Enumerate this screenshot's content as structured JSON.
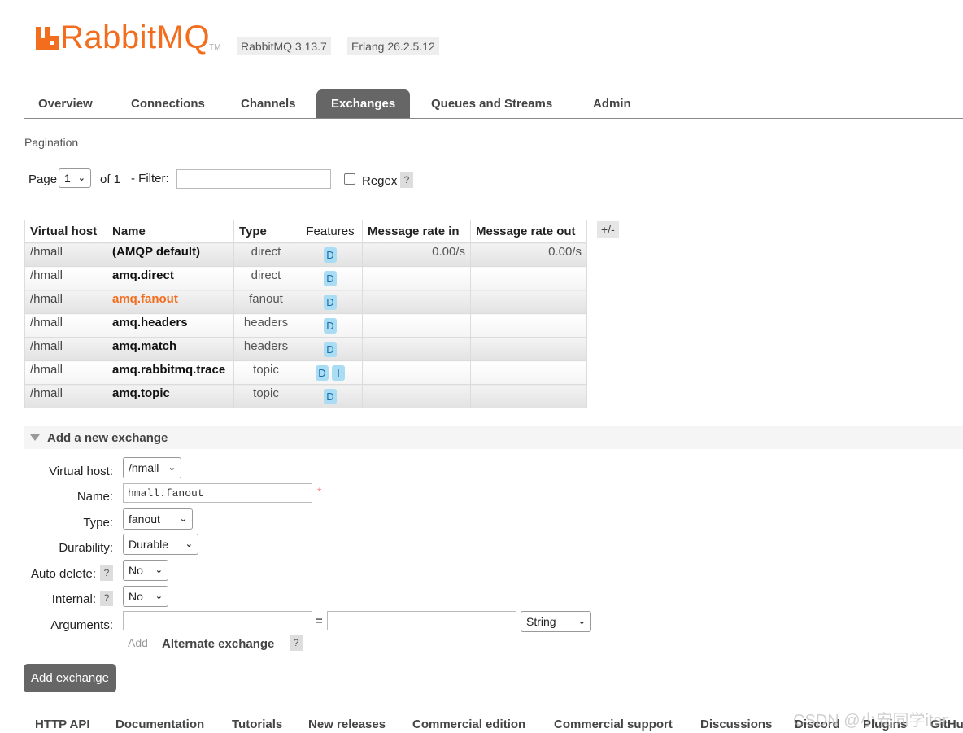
{
  "header": {
    "logo_text": "RabbitMQ",
    "logo_tm": "TM",
    "rabbitmq_version": "RabbitMQ 3.13.7",
    "erlang_version": "Erlang 26.2.5.12",
    "brand_color": "#f36d1f"
  },
  "tabs": [
    {
      "label": "Overview",
      "active": false
    },
    {
      "label": "Connections",
      "active": false
    },
    {
      "label": "Channels",
      "active": false
    },
    {
      "label": "Exchanges",
      "active": true
    },
    {
      "label": "Queues and Streams",
      "active": false
    },
    {
      "label": "Admin",
      "active": false
    }
  ],
  "pagination": {
    "section_label": "Pagination",
    "page_label": "Page",
    "page_value": "1",
    "of_label": "of 1",
    "filter_label": "- Filter:",
    "filter_value": "",
    "regex_label": "Regex",
    "regex_checked": false,
    "help": "?"
  },
  "table": {
    "columns": {
      "virtual_host": "Virtual host",
      "name": "Name",
      "type": "Type",
      "features": "Features",
      "rate_in": "Message rate in",
      "rate_out": "Message rate out"
    },
    "toggle_columns": "+/-",
    "rows": [
      {
        "vhost": "/hmall",
        "name": "(AMQP default)",
        "type": "direct",
        "f1": "D",
        "f2": "",
        "rate_in": "0.00/s",
        "rate_out": "0.00/s",
        "highlight": false
      },
      {
        "vhost": "/hmall",
        "name": "amq.direct",
        "type": "direct",
        "f1": "D",
        "f2": "",
        "rate_in": "",
        "rate_out": "",
        "highlight": false
      },
      {
        "vhost": "/hmall",
        "name": "amq.fanout",
        "type": "fanout",
        "f1": "D",
        "f2": "",
        "rate_in": "",
        "rate_out": "",
        "highlight": true
      },
      {
        "vhost": "/hmall",
        "name": "amq.headers",
        "type": "headers",
        "f1": "D",
        "f2": "",
        "rate_in": "",
        "rate_out": "",
        "highlight": false
      },
      {
        "vhost": "/hmall",
        "name": "amq.match",
        "type": "headers",
        "f1": "D",
        "f2": "",
        "rate_in": "",
        "rate_out": "",
        "highlight": false
      },
      {
        "vhost": "/hmall",
        "name": "amq.rabbitmq.trace",
        "type": "topic",
        "f1": "D",
        "f2": "I",
        "rate_in": "",
        "rate_out": "",
        "highlight": false
      },
      {
        "vhost": "/hmall",
        "name": "amq.topic",
        "type": "topic",
        "f1": "D",
        "f2": "",
        "rate_in": "",
        "rate_out": "",
        "highlight": false
      }
    ]
  },
  "add_exchange": {
    "title": "Add a new exchange",
    "virtual_host_label": "Virtual host:",
    "virtual_host_value": "/hmall",
    "name_label": "Name:",
    "name_value": "hmall.fanout",
    "required_mark": "*",
    "type_label": "Type:",
    "type_value": "fanout",
    "durability_label": "Durability:",
    "durability_value": "Durable",
    "auto_delete_label": "Auto delete:",
    "auto_delete_value": "No",
    "internal_label": "Internal:",
    "internal_value": "No",
    "arguments_label": "Arguments:",
    "arg_key": "",
    "equals": "=",
    "arg_value": "",
    "arg_type": "String",
    "add_label": "Add",
    "alternate_exchange": "Alternate exchange",
    "help": "?",
    "submit": "Add exchange"
  },
  "footer": {
    "links": [
      "HTTP API",
      "Documentation",
      "Tutorials",
      "New releases",
      "Commercial edition",
      "Commercial support",
      "Discussions",
      "Discord",
      "Plugins",
      "GitHu"
    ]
  },
  "watermark": "CSDN @小安同学iter"
}
